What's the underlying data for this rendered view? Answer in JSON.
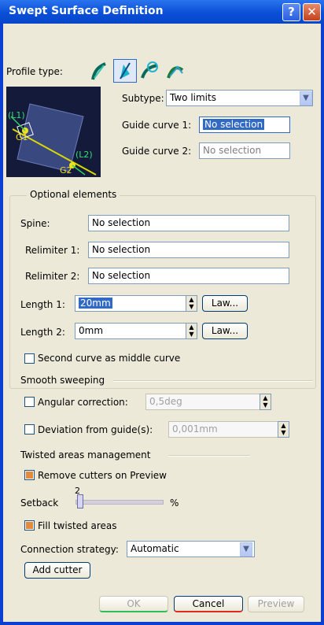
{
  "window": {
    "title": "Swept Surface Definition",
    "help_glyph": "?",
    "close_glyph": "✕"
  },
  "profile": {
    "label": "Profile type:",
    "types": [
      "explicit-profile-icon",
      "line-profile-icon",
      "circle-profile-icon",
      "conic-profile-icon"
    ],
    "active_index": 1
  },
  "preview": {
    "labels": {
      "l1": "(L1)",
      "g1": "G1",
      "l2": "(L2)",
      "g2": "G2"
    }
  },
  "subtype": {
    "label": "Subtype:",
    "value": "Two limits"
  },
  "guide1": {
    "label": "Guide curve 1:",
    "value": "No selection"
  },
  "guide2": {
    "label": "Guide curve 2:",
    "value": "No selection"
  },
  "optional": {
    "title": "Optional elements",
    "spine": {
      "label": "Spine:",
      "value": "No selection"
    },
    "relimiter1": {
      "label": "Relimiter 1:",
      "value": "No selection"
    },
    "relimiter2": {
      "label": "Relimiter 2:",
      "value": "No selection"
    },
    "length1": {
      "label": "Length 1:",
      "value": "20mm",
      "law": "Law..."
    },
    "length2": {
      "label": "Length 2:",
      "value": "0mm",
      "law": "Law..."
    },
    "second_curve": {
      "label": "Second curve as middle curve",
      "checked": false
    }
  },
  "smooth": {
    "title": "Smooth sweeping",
    "angular": {
      "label": "Angular correction:",
      "value": "0,5deg",
      "checked": false
    },
    "deviation": {
      "label": "Deviation from guide(s):",
      "value": "0,001mm",
      "checked": false
    }
  },
  "twisted": {
    "title": "Twisted areas management",
    "remove_cutters": {
      "label": "Remove cutters on Preview",
      "checked": true
    },
    "setback": {
      "label": "Setback",
      "value": "2",
      "unit": "%",
      "level_percent": 2
    },
    "fill": {
      "label": "Fill twisted areas",
      "checked": true
    },
    "connection": {
      "label": "Connection strategy:",
      "value": "Automatic"
    },
    "add_cutter": "Add cutter"
  },
  "footer": {
    "ok": "OK",
    "cancel": "Cancel",
    "preview": "Preview"
  },
  "colors": {
    "title_bar": "#0a4fd8",
    "selection": "#316ac5",
    "checked": "#e38a3c",
    "dialog_bg": "#ece9d8"
  }
}
